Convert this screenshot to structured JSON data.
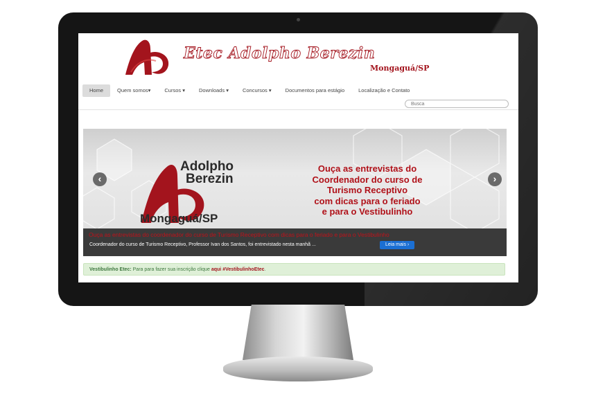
{
  "site": {
    "title": "Etec Adolpho Berezin",
    "subtitle": "Mongaguá/SP"
  },
  "nav": {
    "items": [
      {
        "label": "Home",
        "active": true
      },
      {
        "label": "Quem somos▾",
        "active": false
      },
      {
        "label": "Cursos ▾",
        "active": false
      },
      {
        "label": "Downloads ▾",
        "active": false
      },
      {
        "label": "Concursos ▾",
        "active": false
      },
      {
        "label": "Documentos para estágio",
        "active": false
      },
      {
        "label": "Localização e Contato",
        "active": false
      }
    ],
    "search_placeholder": "Busca"
  },
  "carousel": {
    "logo_line1": "Adolpho",
    "logo_line2": "Berezin",
    "logo_city": "Mongaguá/SP",
    "message": [
      "Ouça as entrevistas do",
      "Coordenador do curso de",
      "Turismo Receptivo",
      "com dicas para o feriado",
      "e para o Vestibulinho"
    ],
    "caption_title": "Ouça as entrevistas do coordenador do curso de Turismo Receptivo com dicas para o feriado e para o Vestibulinho",
    "caption_text": "Coordenador do curso de Turismo Receptivo, Professor Ivan dos Santos, foi entrevistado nesta manhã ...",
    "read_more": "Leia mais ›",
    "prev": "‹",
    "next": "›"
  },
  "alert": {
    "label": "Vestibulinho Etec:",
    "text": " Para para fazer sua inscrição clique ",
    "link": "aqui",
    "tag": " #VestibulinhoEtec",
    "end": "."
  },
  "colors": {
    "brand_red": "#a3141d",
    "alert_green": "#3c763d",
    "button_blue": "#1b6fd3"
  }
}
